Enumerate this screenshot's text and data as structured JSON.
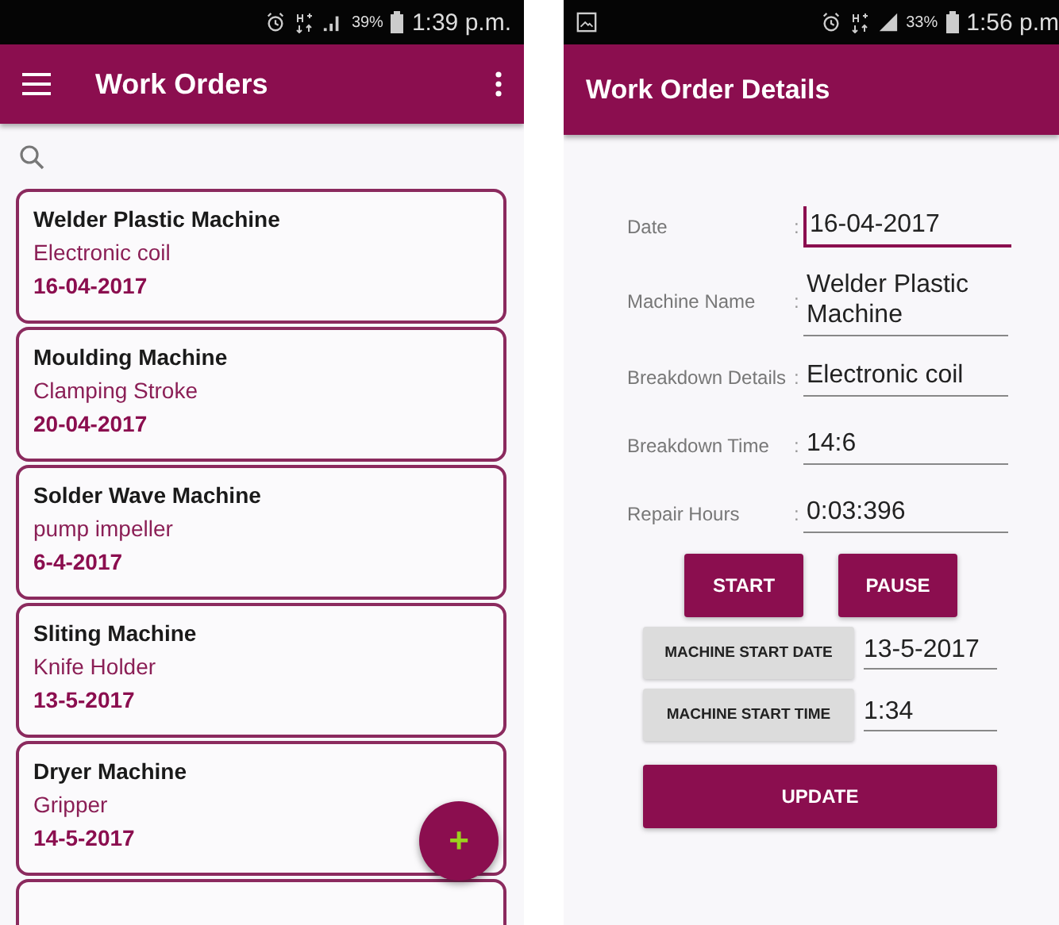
{
  "list_screen": {
    "status_bar": {
      "battery": "39%",
      "time": "1:39 p.m."
    },
    "app_bar": {
      "title": "Work Orders"
    },
    "work_orders": [
      {
        "machine": "Welder Plastic Machine",
        "part": "Electronic coil",
        "date": "16-04-2017"
      },
      {
        "machine": "Moulding Machine",
        "part": "Clamping Stroke",
        "date": "20-04-2017"
      },
      {
        "machine": "Solder Wave Machine",
        "part": "pump impeller",
        "date": "6-4-2017"
      },
      {
        "machine": "Sliting Machine",
        "part": "Knife Holder",
        "date": "13-5-2017"
      },
      {
        "machine": "Dryer Machine",
        "part": "Gripper",
        "date": "14-5-2017"
      }
    ],
    "fab": {
      "label": "+"
    }
  },
  "details_screen": {
    "status_bar": {
      "battery": "33%",
      "time": "1:56 p.m"
    },
    "app_bar": {
      "title": "Work Order Details"
    },
    "fields": [
      {
        "label": "Date",
        "separator": ":",
        "value": "16-04-2017",
        "focused": true
      },
      {
        "label": "Machine Name",
        "separator": ":",
        "value": "Welder Plastic Machine",
        "focused": false
      },
      {
        "label": "Breakdown Details",
        "separator": ":",
        "value": "Electronic coil",
        "focused": false
      },
      {
        "label": "Breakdown Time",
        "separator": ":",
        "value": "14:6",
        "focused": false
      },
      {
        "label": "Repair Hours",
        "separator": ":",
        "value": "0:03:396",
        "focused": false
      }
    ],
    "timer_buttons": [
      "START",
      "PAUSE"
    ],
    "start_rows": [
      {
        "button": "MACHINE START DATE",
        "value": "13-5-2017"
      },
      {
        "button": "MACHINE START TIME",
        "value": "1:34"
      }
    ],
    "update_button": "UPDATE"
  }
}
